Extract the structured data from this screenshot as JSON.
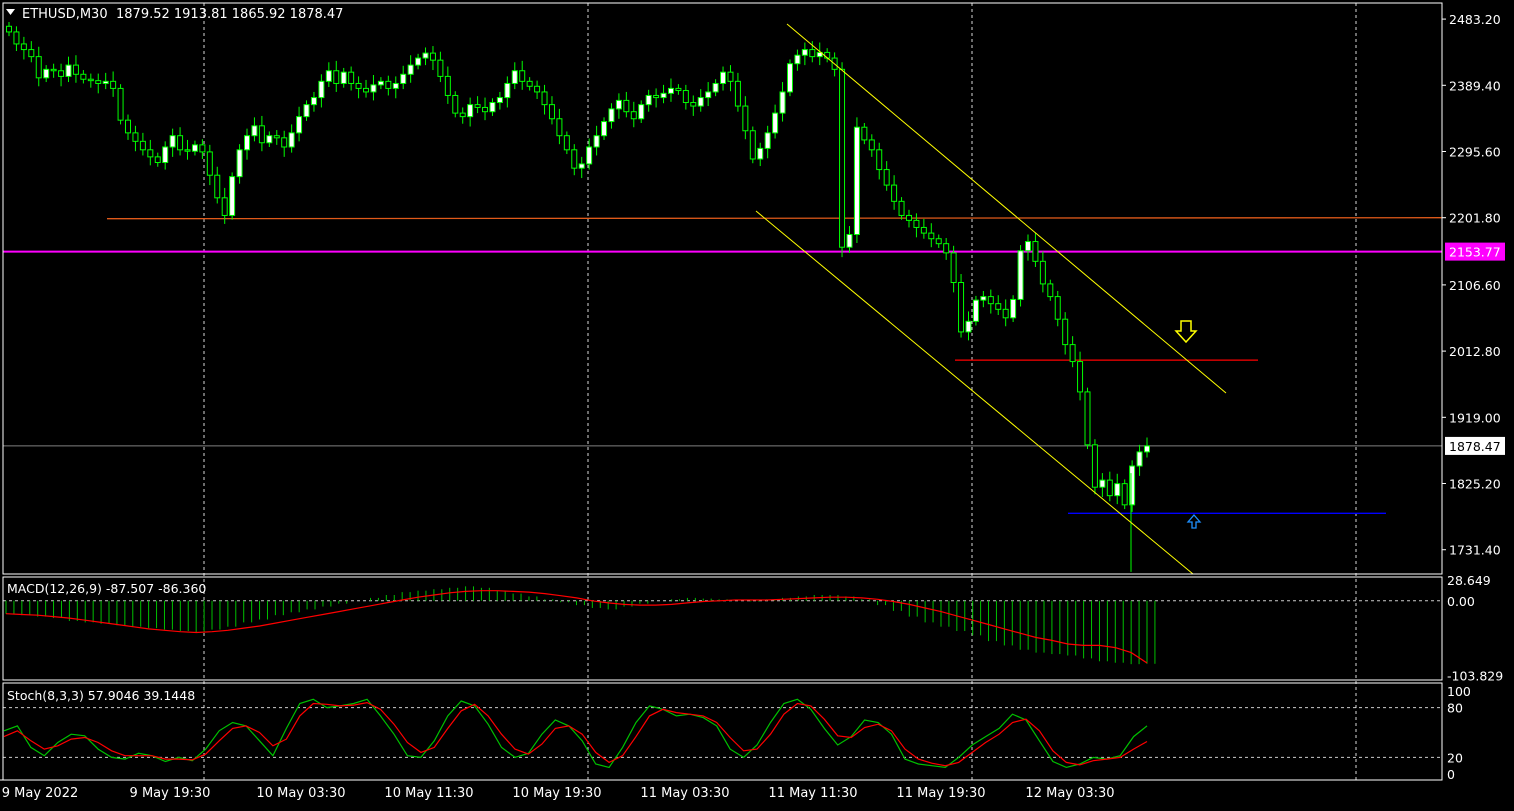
{
  "colors": {
    "background": "#000000",
    "grid": "#ffffff",
    "frame": "#ffffff",
    "candle_bull": "#ffffff",
    "candle_outline": "#00ff00",
    "channel": "#ffff00",
    "support_red": "#ff0000",
    "level_orange": "#e05a1a",
    "level_magenta": "#ff00ff",
    "level_blue": "#0000ff",
    "bid_line": "#808080",
    "macd_hist": "#00c000",
    "macd_signal": "#ff0000",
    "stoch_main": "#00c000",
    "stoch_signal": "#ff0000",
    "arrow_down": "#ffff00",
    "arrow_up": "#1e90ff"
  },
  "header": {
    "symbol_label": "ETHUSD,M30",
    "ohlc": "1879.52 1913.81 1865.92 1878.47"
  },
  "chart_data": [
    {
      "type": "candlestick",
      "title": "ETHUSD,M30",
      "y_axis_ticks": [
        2483.2,
        2389.4,
        2295.6,
        2201.8,
        2106.6,
        2012.8,
        1919.0,
        1825.2,
        1731.4
      ],
      "y_axis_tick_labels": [
        "2483.20",
        "2389.40",
        "2295.60",
        "2201.80",
        "2106.60",
        "2012.80",
        "1919.00",
        "1825.20",
        "1731.40"
      ],
      "ylim": [
        1697,
        2506
      ],
      "x_axis_tick_labels": [
        "9 May 2022",
        "9 May 19:30",
        "10 May 03:30",
        "10 May 11:30",
        "10 May 19:30",
        "11 May 03:30",
        "11 May 11:30",
        "11 May 19:30",
        "12 May 03:30"
      ],
      "bars_visible": 144,
      "close_series_approx": [
        2465,
        2448,
        2440,
        2430,
        2400,
        2412,
        2410,
        2402,
        2418,
        2405,
        2398,
        2396,
        2392,
        2395,
        2385,
        2340,
        2322,
        2310,
        2298,
        2288,
        2280,
        2302,
        2318,
        2298,
        2296,
        2305,
        2295,
        2262,
        2230,
        2205,
        2260,
        2298,
        2318,
        2332,
        2308,
        2318,
        2315,
        2302,
        2322,
        2345,
        2362,
        2372,
        2395,
        2410,
        2392,
        2408,
        2392,
        2385,
        2380,
        2390,
        2395,
        2385,
        2392,
        2405,
        2418,
        2428,
        2435,
        2425,
        2402,
        2375,
        2350,
        2345,
        2362,
        2358,
        2352,
        2365,
        2372,
        2392,
        2410,
        2395,
        2388,
        2380,
        2362,
        2342,
        2318,
        2298,
        2272,
        2278,
        2302,
        2318,
        2338,
        2356,
        2368,
        2352,
        2342,
        2362,
        2375,
        2372,
        2378,
        2385,
        2382,
        2365,
        2360,
        2372,
        2380,
        2392,
        2408,
        2395,
        2360,
        2325,
        2285,
        2300,
        2322,
        2350,
        2380,
        2420,
        2432,
        2440,
        2430,
        2436,
        2428,
        2412,
        2160,
        2178,
        2330,
        2312,
        2298,
        2270,
        2248,
        2225,
        2205,
        2198,
        2188,
        2180,
        2172,
        2165,
        2152,
        2110,
        2040,
        2055,
        2085,
        2090,
        2080,
        2072,
        2060,
        2086,
        2155,
        2168,
        2140,
        2108,
        2090,
        2058,
        2022,
        1998,
        1955,
        1880,
        1820,
        1830,
        1808,
        1825,
        1795,
        1850,
        1870,
        1878.47
      ],
      "last_price": 1878.47,
      "last_price_label": "1878.47",
      "horizontal_levels": [
        {
          "name": "orange-level",
          "value": 2201.8
        },
        {
          "name": "magenta-level",
          "value": 2153.77,
          "label": "2153.77"
        },
        {
          "name": "red-level",
          "value": 2000
        },
        {
          "name": "blue-level",
          "value": 1783
        }
      ],
      "channel_upper": [
        {
          "bar": 113,
          "price": 2480
        },
        {
          "bar": 175,
          "price": 1950
        }
      ],
      "channel_lower": [
        {
          "bar": 107,
          "price": 2210
        },
        {
          "bar": 170,
          "price": 1695
        }
      ],
      "annotations": [
        {
          "type": "arrow-down",
          "bar": 171,
          "price": 2030
        },
        {
          "type": "arrow-up",
          "bar": 171,
          "price": 1760
        }
      ]
    },
    {
      "type": "bar",
      "title": "MACD(12,26,9)",
      "label": "MACD(12,26,9) -87.507 -86.360",
      "y_axis_tick_labels": [
        "28.649",
        "0.00",
        "-103.829"
      ],
      "ylim": [
        -110,
        33
      ],
      "hist_approx": [
        -18,
        -20,
        -22,
        -24,
        -28,
        -30,
        -32,
        -34,
        -36,
        -38,
        -40,
        -42,
        -44,
        -40,
        -36,
        -30,
        -26,
        -20,
        -16,
        -12,
        -8,
        -4,
        0,
        4,
        8,
        12,
        14,
        16,
        18,
        20,
        18,
        14,
        10,
        6,
        2,
        -2,
        -6,
        -10,
        -12,
        -8,
        -4,
        0,
        2,
        4,
        3,
        2,
        0,
        -1,
        2,
        4,
        6,
        8,
        8,
        6,
        2,
        -6,
        -14,
        -22,
        -30,
        -36,
        -42,
        -48,
        -56,
        -62,
        -68,
        -72,
        -74,
        -76,
        -80,
        -84,
        -86,
        -88,
        -87.5
      ],
      "signal_approx": [
        -18,
        -19,
        -20,
        -22,
        -24,
        -27,
        -30,
        -33,
        -36,
        -39,
        -41,
        -43,
        -44,
        -43,
        -41,
        -38,
        -35,
        -31,
        -27,
        -23,
        -19,
        -15,
        -11,
        -7,
        -3,
        1,
        5,
        8,
        11,
        13,
        14,
        14,
        13,
        12,
        10,
        7,
        4,
        0,
        -3,
        -5,
        -6,
        -6,
        -5,
        -3,
        -1,
        0,
        1,
        1,
        1,
        2,
        3,
        4,
        5,
        5,
        4,
        2,
        -1,
        -5,
        -10,
        -15,
        -21,
        -27,
        -33,
        -39,
        -45,
        -51,
        -55,
        -60,
        -62,
        -62,
        -65,
        -72,
        -86.36
      ]
    },
    {
      "type": "line",
      "title": "Stoch(8,3,3)",
      "label": "Stoch(8,3,3) 57.9046 39.1448",
      "y_axis_tick_labels": [
        "100",
        "80",
        "20",
        "0"
      ],
      "ylim": [
        0,
        100
      ],
      "levels": [
        80,
        20
      ],
      "series": [
        {
          "name": "main",
          "values": [
            52,
            58,
            32,
            22,
            38,
            48,
            46,
            30,
            20,
            18,
            25,
            22,
            15,
            20,
            16,
            30,
            52,
            62,
            58,
            40,
            22,
            55,
            85,
            90,
            80,
            82,
            85,
            90,
            70,
            48,
            22,
            20,
            40,
            70,
            88,
            82,
            60,
            32,
            20,
            25,
            48,
            65,
            58,
            40,
            12,
            8,
            32,
            62,
            82,
            78,
            70,
            72,
            68,
            58,
            30,
            20,
            35,
            62,
            85,
            90,
            78,
            55,
            35,
            45,
            65,
            62,
            48,
            18,
            12,
            10,
            8,
            20,
            35,
            45,
            55,
            72,
            65,
            40,
            15,
            8,
            12,
            20,
            18,
            22,
            45,
            57.9
          ]
        },
        {
          "name": "signal",
          "values": [
            45,
            52,
            40,
            30,
            34,
            42,
            44,
            38,
            28,
            22,
            22,
            22,
            18,
            18,
            17,
            24,
            40,
            55,
            58,
            50,
            34,
            42,
            70,
            85,
            84,
            82,
            83,
            86,
            78,
            60,
            38,
            26,
            32,
            55,
            76,
            84,
            70,
            48,
            30,
            24,
            36,
            55,
            58,
            48,
            26,
            14,
            22,
            45,
            70,
            78,
            74,
            72,
            70,
            62,
            44,
            28,
            30,
            48,
            72,
            85,
            82,
            66,
            46,
            44,
            56,
            60,
            52,
            30,
            18,
            13,
            10,
            14,
            26,
            38,
            48,
            62,
            66,
            52,
            28,
            14,
            11,
            16,
            18,
            20,
            30,
            39.1
          ]
        }
      ]
    }
  ]
}
